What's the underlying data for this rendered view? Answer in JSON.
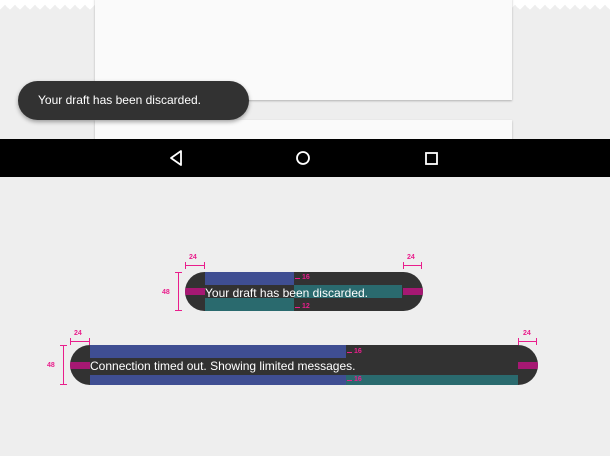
{
  "snackbar_demo": {
    "message": "Your draft has been discarded."
  },
  "navbar": {
    "back_icon": "back-triangle-icon",
    "home_icon": "home-circle-icon",
    "recents_icon": "recents-square-icon"
  },
  "spec_single": {
    "message": "Your draft has been discarded.",
    "padding_left": "24",
    "padding_right": "24",
    "height": "48",
    "top_padding": "16",
    "bottom_padding": "12"
  },
  "spec_long": {
    "message": "Connection timed out. Showing limited messages.",
    "padding_left": "24",
    "padding_right": "24",
    "height": "48",
    "top_padding": "16",
    "bottom_padding": "16"
  },
  "colors": {
    "snackbar_bg": "#323232",
    "redline": "#e91e8c",
    "navbar_bg": "#000000",
    "page_bg": "#eeeeee"
  }
}
